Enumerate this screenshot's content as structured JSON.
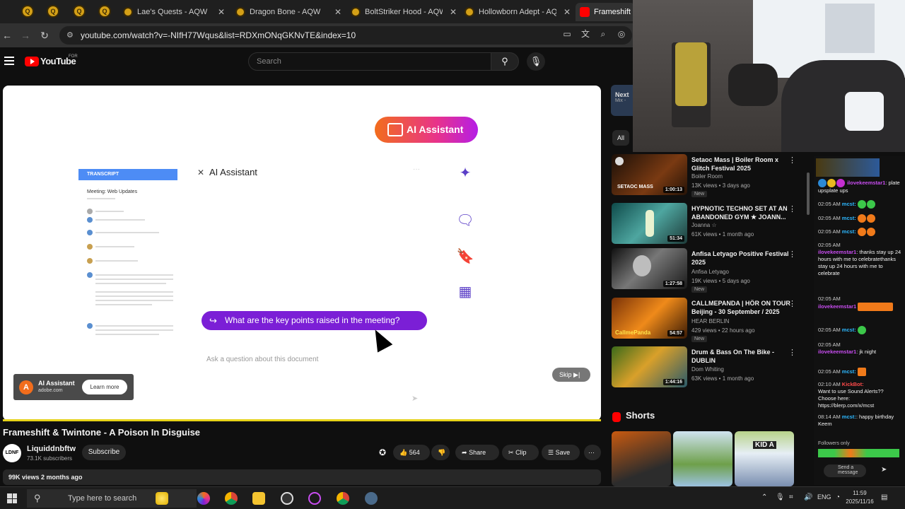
{
  "browser": {
    "tabs": [
      {
        "label": "Lae's Quests - AQW"
      },
      {
        "label": "Dragon Bone - AQW"
      },
      {
        "label": "BoltStriker Hood - AQW"
      },
      {
        "label": "Hollowborn Adept - AQ"
      },
      {
        "label": "Frameshift &"
      }
    ],
    "url": "youtube.com/watch?v=-NIfH77Wqus&list=RDXmONqGKNvTE&index=10"
  },
  "youtube": {
    "logo_text": "YouTube",
    "country": "FOR",
    "search_placeholder": "Search"
  },
  "ad": {
    "ai_button": "AI Assistant",
    "doc_tag": "TRANSCRIPT",
    "doc_title": "Meeting: Web Updates",
    "panel_title": "AI Assistant",
    "question": "What are the key points raised in the meeting?",
    "ask_placeholder": "Ask a question about this document",
    "advertiser_name": "AI Assistant",
    "advertiser_domain": "adobe.com",
    "learn_more": "Learn more",
    "skip": "Skip"
  },
  "video": {
    "title": "Frameshift & Twintone - A Poison In Disguise",
    "channel": "Liquiddnbftw",
    "channel_avatar": "LDNF",
    "subscribers": "73.1K subscribers",
    "subscribe": "Subscribe",
    "likes": "564",
    "share": "Share",
    "clip": "Clip",
    "save": "Save",
    "views_date": "99K views  2 months ago"
  },
  "sidebar": {
    "next_label": "Next",
    "next_sub": "Mix -",
    "chip_all": "All",
    "recommendations": [
      {
        "title": "Setaoc Mass | Boiler Room x Glitch Festival 2025",
        "channel": "Boiler Room",
        "stats": "13K views • 3 days ago",
        "badge": "New",
        "duration": "1:00:13"
      },
      {
        "title": "HYPNOTIC TECHNO SET AT AN ABANDONED GYM ★ JOANN...",
        "channel": "Joanna ☆",
        "stats": "61K views • 1 month ago",
        "badge": "",
        "duration": "51:34"
      },
      {
        "title": "Anfisa Letyago Positive Festival 2025",
        "channel": "Anfisa Letyago",
        "stats": "19K views • 5 days ago",
        "badge": "New",
        "duration": "1:27:58"
      },
      {
        "title": "CALLMEPANDA | HÖR ON TOUR Beijing - 30 September / 2025",
        "channel": "HEAR BERLIN",
        "stats": "429 views • 22 hours ago",
        "badge": "New",
        "duration": "54:57"
      },
      {
        "title": "Drum & Bass On The Bike - DUBLIN",
        "channel": "Dom Whiting",
        "stats": "63K views • 1 month ago",
        "badge": "",
        "duration": "1:44:16"
      }
    ],
    "shorts_title": "Shorts"
  },
  "chat": {
    "messages": [
      {
        "time": "",
        "user": "ilovekeemstar1",
        "text": ": plate upsplate ups"
      },
      {
        "time": "02:05 AM",
        "user": "mcst:",
        "text": ""
      },
      {
        "time": "02:05 AM",
        "user": "mcst:",
        "text": ""
      },
      {
        "time": "02:05 AM",
        "user": "mcst:",
        "text": ""
      },
      {
        "time": "02:05 AM",
        "user": "ilovekeemstar1",
        "text": ": thanks stay up 24 hours with me to celebratethanks stay up 24 hours with me to celebrate"
      },
      {
        "time": "02:05 AM",
        "user": "ilovekeemstar1",
        "text": ""
      },
      {
        "time": "02:05 AM",
        "user": "mcst:",
        "text": ""
      },
      {
        "time": "02:05 AM",
        "user": "ilovekeemstar1",
        "text": ": jk night"
      },
      {
        "time": "02:05 AM",
        "user": "mcst:",
        "text": ""
      },
      {
        "time": "02:10 AM",
        "user": "KickBot:",
        "text": "Want to use Sound Alerts?? Choose here: https://blerp.com/x/mcst"
      },
      {
        "time": "08:14 AM",
        "user": "mcst:",
        "text": ": happy birthday Keem"
      }
    ],
    "followers_only": "Followers only",
    "send_placeholder": "Send a message"
  },
  "taskbar": {
    "search_placeholder": "Type here to search",
    "language": "ENG",
    "time": "11:59",
    "date": "2025/11/16"
  }
}
